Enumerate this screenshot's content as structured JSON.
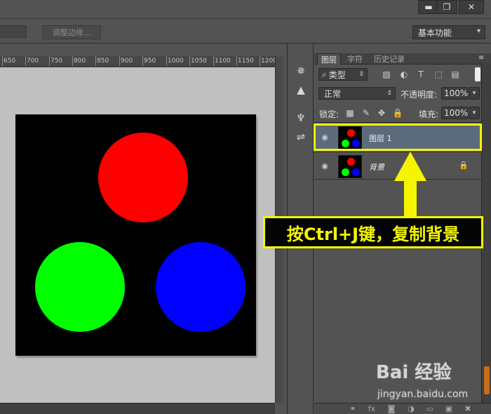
{
  "window_controls": {
    "minimize": "▬",
    "restore": "❐",
    "close": "✕"
  },
  "options_bar": {
    "refine_edge_label": "调整边缘...",
    "workspace_value": "基本功能"
  },
  "ruler": {
    "labels": [
      "650",
      "700",
      "750",
      "800",
      "850",
      "900",
      "950",
      "1000",
      "1050",
      "1100",
      "1150",
      "1200"
    ]
  },
  "document": {
    "background": "#000000",
    "circles": [
      {
        "name": "red-circle",
        "color": "#ff0000"
      },
      {
        "name": "green-circle",
        "color": "#00ff00"
      },
      {
        "name": "blue-circle",
        "color": "#0000ff"
      }
    ]
  },
  "layers_panel": {
    "tabs": [
      "图层",
      "字符",
      "历史记录"
    ],
    "active_tab": "图层",
    "filter_kind": "类型",
    "blend_mode": "正常",
    "opacity_label": "不透明度:",
    "opacity_value": "100%",
    "lock_label": "锁定:",
    "fill_label": "填充:",
    "fill_value": "100%",
    "layers": [
      {
        "name": "图层 1",
        "selected": true,
        "locked": false
      },
      {
        "name": "背景",
        "selected": false,
        "locked": true
      }
    ]
  },
  "annotation": {
    "callout_text": "按Ctrl+J键，复制背景",
    "color": "#f5f500"
  },
  "watermark": {
    "logo": "Bai 经验",
    "url": "jingyan.baidu.com"
  },
  "icons": {
    "search": "⌕",
    "eye": "👁",
    "lock": "🔒",
    "link": "⚭",
    "fx": "fx",
    "new_layer": "▣",
    "trash": "🗑"
  }
}
